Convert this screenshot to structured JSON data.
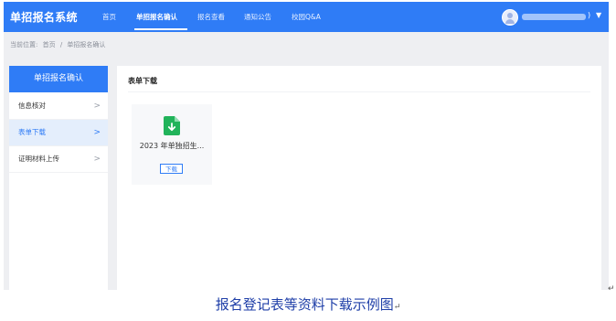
{
  "app": {
    "title": "单招报名系统"
  },
  "nav": {
    "items": [
      {
        "label": "首页",
        "active": false
      },
      {
        "label": "单招报名确认",
        "active": true
      },
      {
        "label": "报名查看",
        "active": false
      },
      {
        "label": "通知公告",
        "active": false
      },
      {
        "label": "校园Q&A",
        "active": false
      }
    ]
  },
  "user": {
    "paren": ")",
    "caret": "▼"
  },
  "breadcrumb": {
    "prefix": "当前位置:",
    "home": "首页",
    "separator": "/",
    "current": "单招报名确认"
  },
  "sidebar": {
    "header": "单招报名确认",
    "items": [
      {
        "label": "信息核对",
        "active": false
      },
      {
        "label": "表单下载",
        "active": true
      },
      {
        "label": "证明材料上传",
        "active": false
      }
    ],
    "chevron": ">"
  },
  "main": {
    "title": "表单下载",
    "file": {
      "name": "2023 年单独招生...",
      "download_label": "下载",
      "icon": "file-download-icon"
    }
  },
  "caption": {
    "text": "报名登记表等资料下载示例图",
    "mark": "↵"
  },
  "colors": {
    "primary": "#2f7cf6",
    "file_icon": "#21b35a"
  }
}
